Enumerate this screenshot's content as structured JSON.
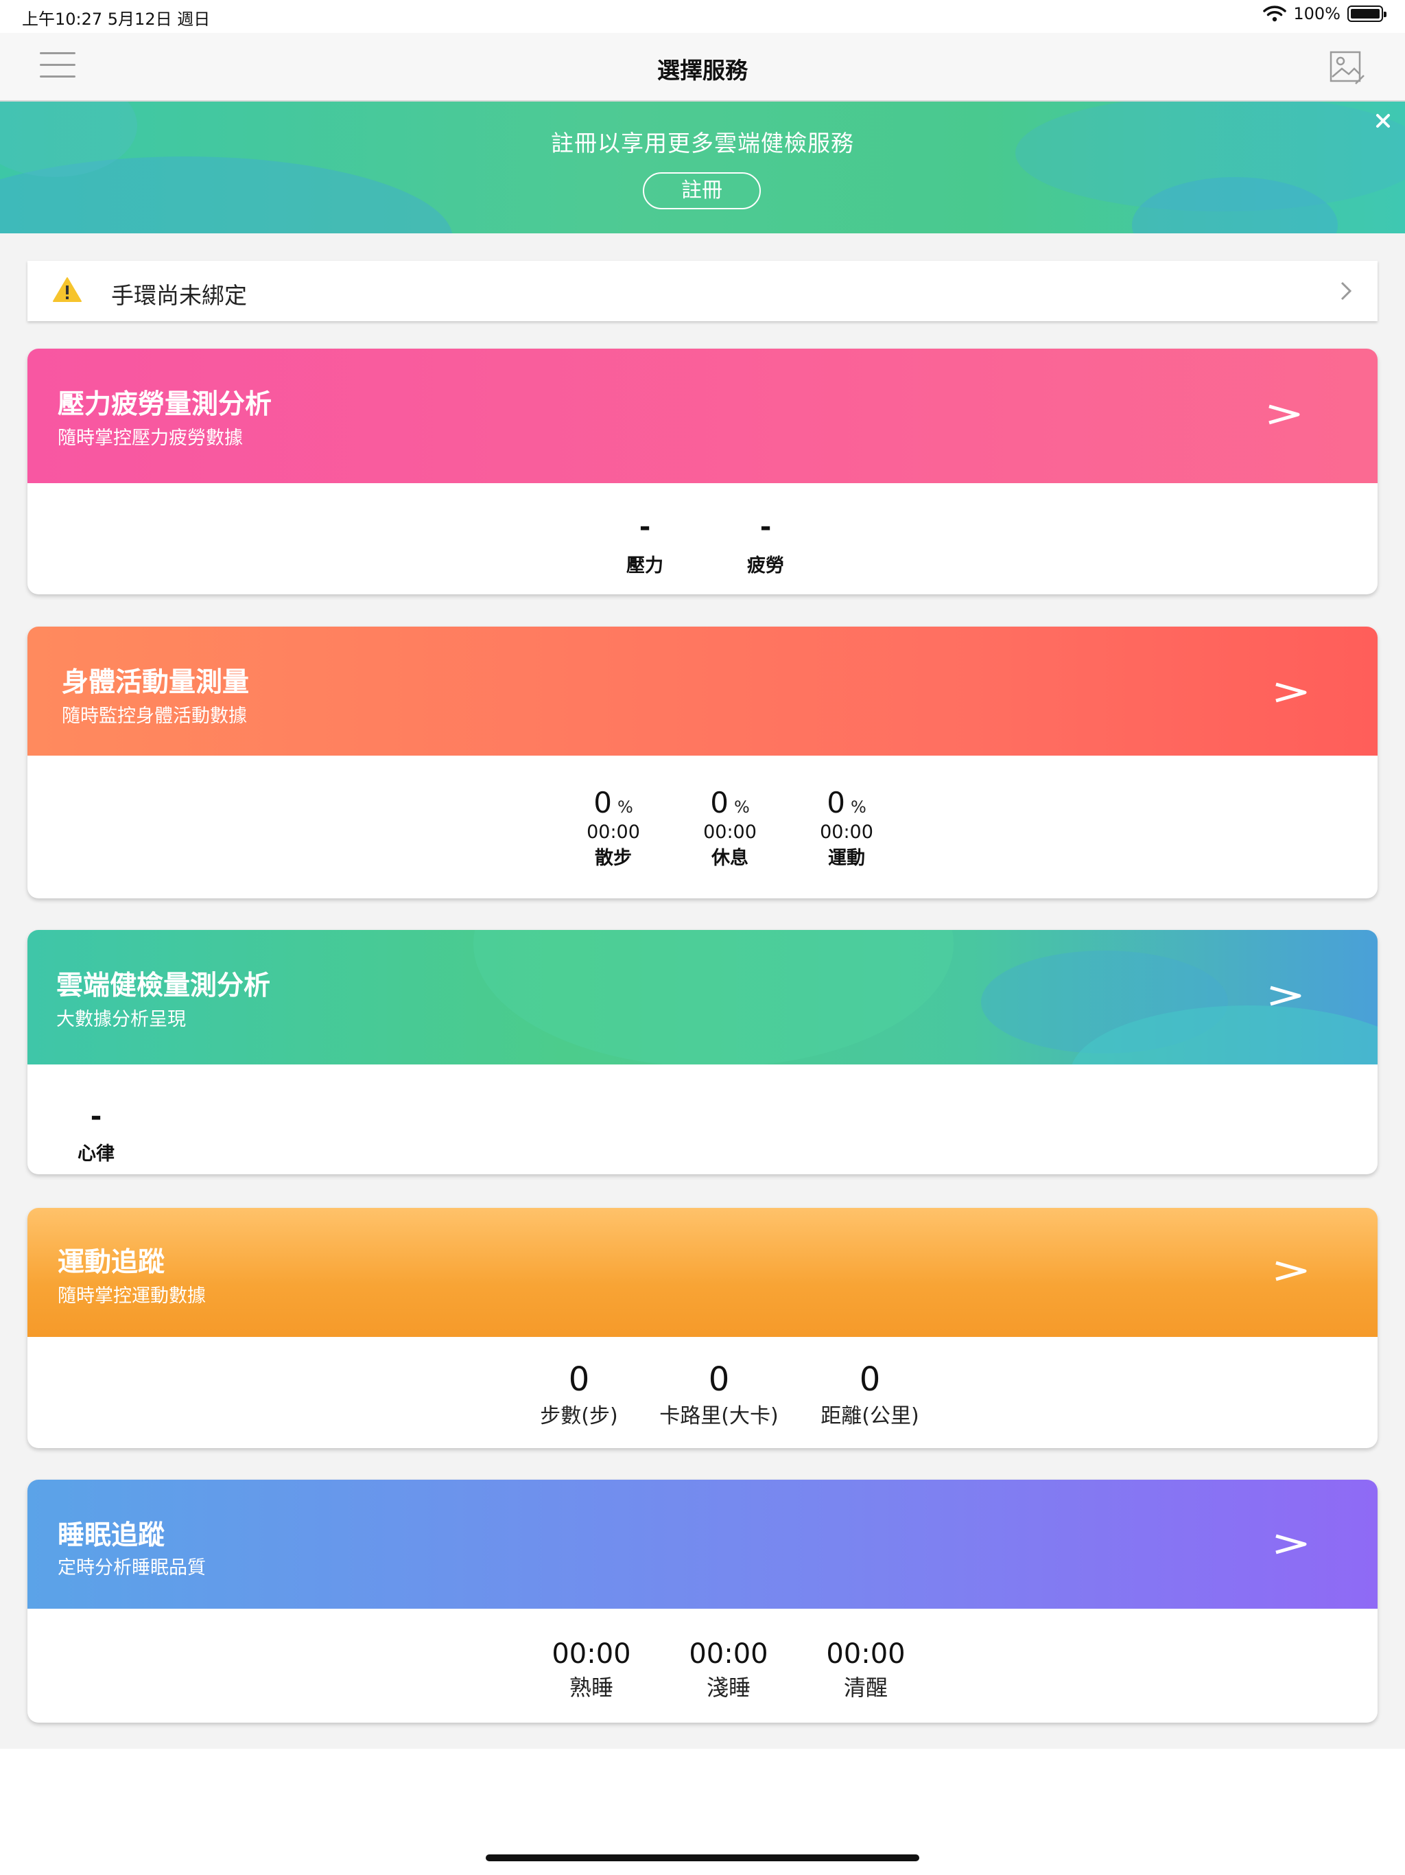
{
  "status_bar": {
    "time_date": "上午10:27   5月12日 週日",
    "battery": "100%"
  },
  "nav": {
    "title": "選擇服務"
  },
  "banner": {
    "text": "註冊以享用更多雲端健檢服務",
    "button": "註冊",
    "close": "×"
  },
  "notice": {
    "text": "手環尚未綁定"
  },
  "cards": {
    "stress": {
      "title": "壓力疲勞量測分析",
      "subtitle": "隨時掌控壓力疲勞數據",
      "metrics": [
        {
          "value": "-",
          "label": "壓力"
        },
        {
          "value": "-",
          "label": "疲勞"
        }
      ]
    },
    "activity": {
      "title": "身體活動量測量",
      "subtitle": "隨時監控身體活動數據",
      "metrics": [
        {
          "value": "0",
          "unit": "%",
          "time": "00:00",
          "label": "散步"
        },
        {
          "value": "0",
          "unit": "%",
          "time": "00:00",
          "label": "休息"
        },
        {
          "value": "0",
          "unit": "%",
          "time": "00:00",
          "label": "運動"
        }
      ]
    },
    "cloud": {
      "title": "雲端健檢量測分析",
      "subtitle": "大數據分析呈現",
      "metrics": [
        {
          "value": "-",
          "label": "心律"
        }
      ]
    },
    "sport": {
      "title": "運動追蹤",
      "subtitle": "隨時掌控運動數據",
      "metrics": [
        {
          "value": "0",
          "label": "步數(步)"
        },
        {
          "value": "0",
          "label": "卡路里(大卡)"
        },
        {
          "value": "0",
          "label": "距離(公里)"
        }
      ]
    },
    "sleep": {
      "title": "睡眠追蹤",
      "subtitle": "定時分析睡眠品質",
      "metrics": [
        {
          "value": "00:00",
          "label": "熟睡"
        },
        {
          "value": "00:00",
          "label": "淺睡"
        },
        {
          "value": "00:00",
          "label": "清醒"
        }
      ]
    }
  }
}
